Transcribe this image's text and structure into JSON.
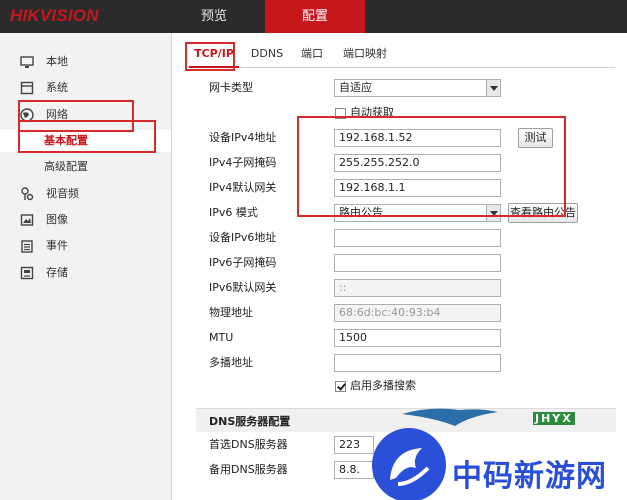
{
  "header": {
    "logo": "HIKVISION",
    "nav": [
      "预览",
      "配置"
    ]
  },
  "sidebar": {
    "items": [
      {
        "label": "本地",
        "icon": "monitor-icon"
      },
      {
        "label": "系统",
        "icon": "system-icon"
      },
      {
        "label": "网络",
        "icon": "globe-icon"
      },
      {
        "label": "基本配置",
        "icon": ""
      },
      {
        "label": "高级配置",
        "icon": ""
      },
      {
        "label": "视音频",
        "icon": "microphone-icon"
      },
      {
        "label": "图像",
        "icon": "image-icon"
      },
      {
        "label": "事件",
        "icon": "event-icon"
      },
      {
        "label": "存储",
        "icon": "storage-icon"
      }
    ]
  },
  "tabs": [
    "TCP/IP",
    "DDNS",
    "端口",
    "端口映射"
  ],
  "form": {
    "nic_type_label": "网卡类型",
    "nic_type_value": "自适应",
    "dhcp_label": "自动获取",
    "ipv4_addr_label": "设备IPv4地址",
    "ipv4_addr_value": "192.168.1.52",
    "test_button": "测试",
    "ipv4_mask_label": "IPv4子网掩码",
    "ipv4_mask_value": "255.255.252.0",
    "ipv4_gw_label": "IPv4默认网关",
    "ipv4_gw_value": "192.168.1.1",
    "ipv6_mode_label": "IPv6 模式",
    "ipv6_mode_value": "路由公告",
    "view_route_button": "查看路由公告",
    "ipv6_addr_label": "设备IPv6地址",
    "ipv6_addr_value": "",
    "ipv6_mask_label": "IPv6子网掩码",
    "ipv6_mask_value": "",
    "ipv6_gw_label": "IPv6默认网关",
    "ipv6_gw_value": "::",
    "mac_label": "物理地址",
    "mac_value": "68:6d:bc:40:93:b4",
    "mtu_label": "MTU",
    "mtu_value": "1500",
    "multicast_label": "多播地址",
    "multicast_value": "",
    "multicast_search_label": "启用多播搜索",
    "dns_section": "DNS服务器配置",
    "dns1_label": "首选DNS服务器",
    "dns1_value": "223",
    "dns2_label": "备用DNS服务器",
    "dns2_value": "8.8."
  },
  "watermark": {
    "text": "中码新游网",
    "tag": "JHYX"
  },
  "colors": {
    "brand_red": "#c8161d",
    "topbar": "#2b2b2b",
    "annotation": "#d52b2b",
    "watermark_blue": "#2a4fd8"
  }
}
